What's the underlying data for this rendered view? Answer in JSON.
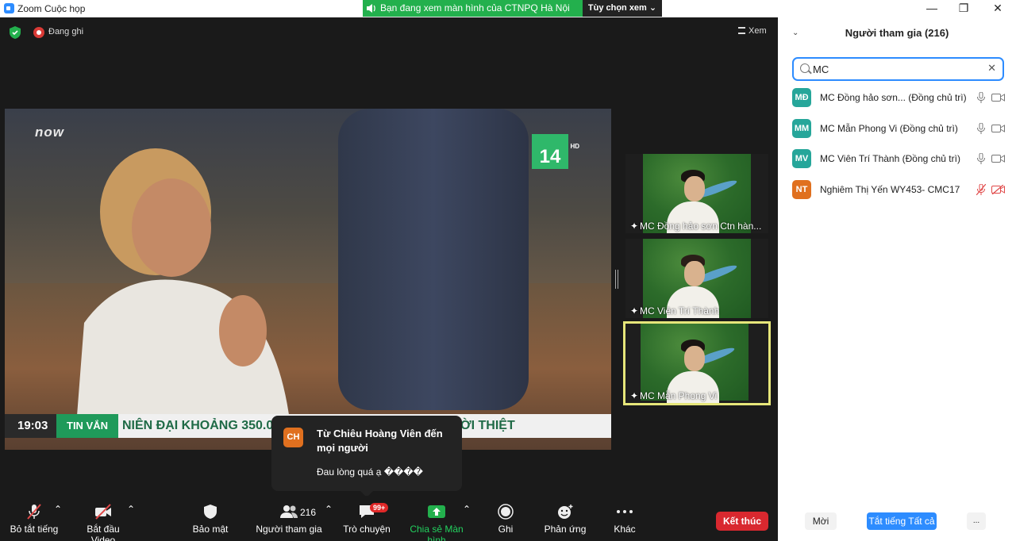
{
  "window": {
    "title": "Zoom Cuộc họp",
    "share_banner": "Bạn đang xem màn hình của CTNPQ Hà Nội",
    "view_options": "Tùy chọn xem",
    "controls": [
      "—",
      "❐",
      "✕"
    ]
  },
  "meeting": {
    "recording_label": "Đang ghi",
    "view_label": "Xem",
    "shared_screen": {
      "watermark": "now",
      "channel_logo": "14",
      "channel_hd": "HD",
      "ticker_time": "19:03",
      "ticker_tag": "TIN VẮN",
      "ticker_text_1": "NIÊN ĐẠI KHOẢNG 350.0",
      "ticker_text_2": "NIGERIA: 10 NGƯỜI THIỆT"
    },
    "gallery": [
      {
        "caption": "MC Đồng hảo sơn Ctn hàn..."
      },
      {
        "caption": "MC Viên Trí Thành"
      },
      {
        "caption": "MC Mẫn Phong Vi"
      }
    ]
  },
  "chat_toast": {
    "avatar": "CH",
    "from": "Từ Chiêu Hoàng Viên đến mọi người",
    "message": "Đau lòng quá ạ ����"
  },
  "toolbar": {
    "mute": "Bỏ tắt tiếng",
    "video": "Bắt đầu Video",
    "security": "Bảo mật",
    "participants_count": "216",
    "participants": "Người tham gia",
    "chat": "Trò chuyện",
    "chat_badge": "99+",
    "share": "Chia sẻ Màn hình",
    "record": "Ghi",
    "reactions": "Phản ứng",
    "more": "Khác",
    "end": "Kết thúc"
  },
  "panel": {
    "title": "Người tham gia (216)",
    "search_value": "MC",
    "participants": [
      {
        "initials": "MĐ",
        "name": "MC Đồng hảo sơn... (Đồng chủ trì)",
        "color": "#26a69a",
        "mic_muted": false,
        "cam_off": false
      },
      {
        "initials": "MM",
        "name": "MC Mẫn Phong Vi (Đồng chủ trì)",
        "color": "#26a69a",
        "mic_muted": false,
        "cam_off": false
      },
      {
        "initials": "MV",
        "name": "MC Viên Trí Thành (Đồng chủ trì)",
        "color": "#26a69a",
        "mic_muted": false,
        "cam_off": false
      },
      {
        "initials": "NT",
        "name": "Nghiêm Thị Yến WY453- CMC17",
        "color": "#e0701f",
        "mic_muted": true,
        "cam_off": true
      }
    ],
    "invite": "Mời",
    "mute_all": "Tắt tiếng Tất cả",
    "more": "..."
  },
  "colors": {
    "accent": "#2d8cff",
    "share_green": "#23b04d",
    "end_red": "#d9282f",
    "muted_red": "#e04848"
  }
}
